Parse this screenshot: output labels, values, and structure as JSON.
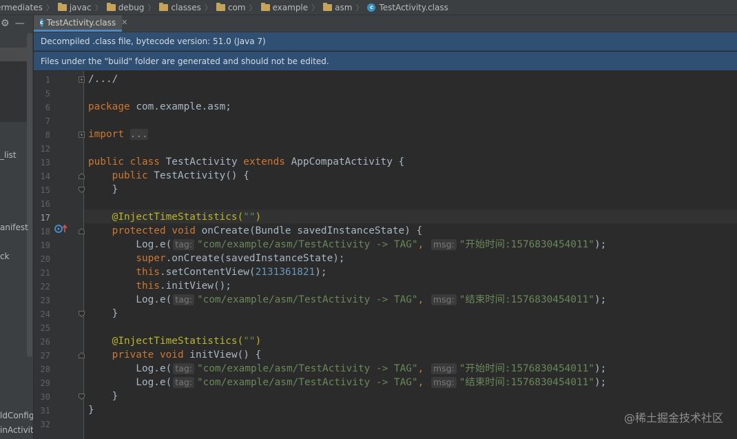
{
  "breadcrumb": [
    {
      "label": "ermediates",
      "icon": "folder-icon"
    },
    {
      "label": "javac",
      "icon": "folder-icon"
    },
    {
      "label": "debug",
      "icon": "folder-icon"
    },
    {
      "label": "classes",
      "icon": "folder-icon"
    },
    {
      "label": "com",
      "icon": "folder-icon"
    },
    {
      "label": "example",
      "icon": "folder-icon"
    },
    {
      "label": "asm",
      "icon": "folder-icon"
    },
    {
      "label": "TestActivity.class",
      "icon": "class-icon"
    }
  ],
  "left_panel": {
    "tree_fragments": [
      "_list",
      "anifest",
      "ck",
      "ldConfig",
      "inActivity"
    ]
  },
  "tab": {
    "label": "TestActivity.class",
    "icon_letter": "c"
  },
  "banners": {
    "decompiled": "Decompiled .class file, bytecode version: 51.0 (Java 7)",
    "build_warning": "Files under the \"build\" folder are generated and should not be edited."
  },
  "editor": {
    "line_numbers": [
      "1",
      "5",
      "6",
      "7",
      "8",
      "12",
      "13",
      "14",
      "15",
      "16",
      "17",
      "18",
      "19",
      "20",
      "21",
      "22",
      "23",
      "24",
      "25",
      "26",
      "27",
      "28",
      "29",
      "30",
      "31",
      "32"
    ],
    "current_line": "17",
    "code": {
      "l1": "/.../",
      "l6_kw": "package",
      "l6_rest": " com.example.asm;",
      "l8_kw": "import",
      "l8_folded": "...",
      "l13_public": "public",
      "l13_class": "class",
      "l13_name": " TestActivity ",
      "l13_extends": "extends",
      "l13_rest": " AppCompatActivity {",
      "l14_public": "public",
      "l14_rest": " TestActivity() {",
      "close_brace": "}",
      "ann": "@InjectTimeStatistics(",
      "ann_str": "\"\"",
      "ann_close": ")",
      "l18_protected": "protected",
      "l18_void": "void",
      "l18_rest": " onCreate(Bundle savedInstanceState) {",
      "log_call": "Log.e(",
      "hint_tag": "tag:",
      "hint_msg": "msg:",
      "tag_str": "\"com/example/asm/TestActivity -> TAG\"",
      "comma": ", ",
      "msg_start": "\"开始时间:1576830454011\"",
      "msg_end": "\"结束时间:1576830454011\"",
      "stmt_end": ");",
      "l20_super": "super",
      "l20_rest": ".onCreate(savedInstanceState);",
      "this": "this",
      "l21_rest": ".setContentView(",
      "l21_num": "2131361821",
      "l22_rest": ".initView();",
      "l27_private": "private",
      "l27_void": "void",
      "l27_rest": " initView() {"
    }
  },
  "watermark": "@稀土掘金技术社区",
  "colors": {
    "keyword": "#cc7832",
    "string": "#6a8759",
    "number": "#6897bb",
    "annotation": "#bbb529",
    "banner": "#2f4f73",
    "editor_bg": "#2b2b2b"
  }
}
